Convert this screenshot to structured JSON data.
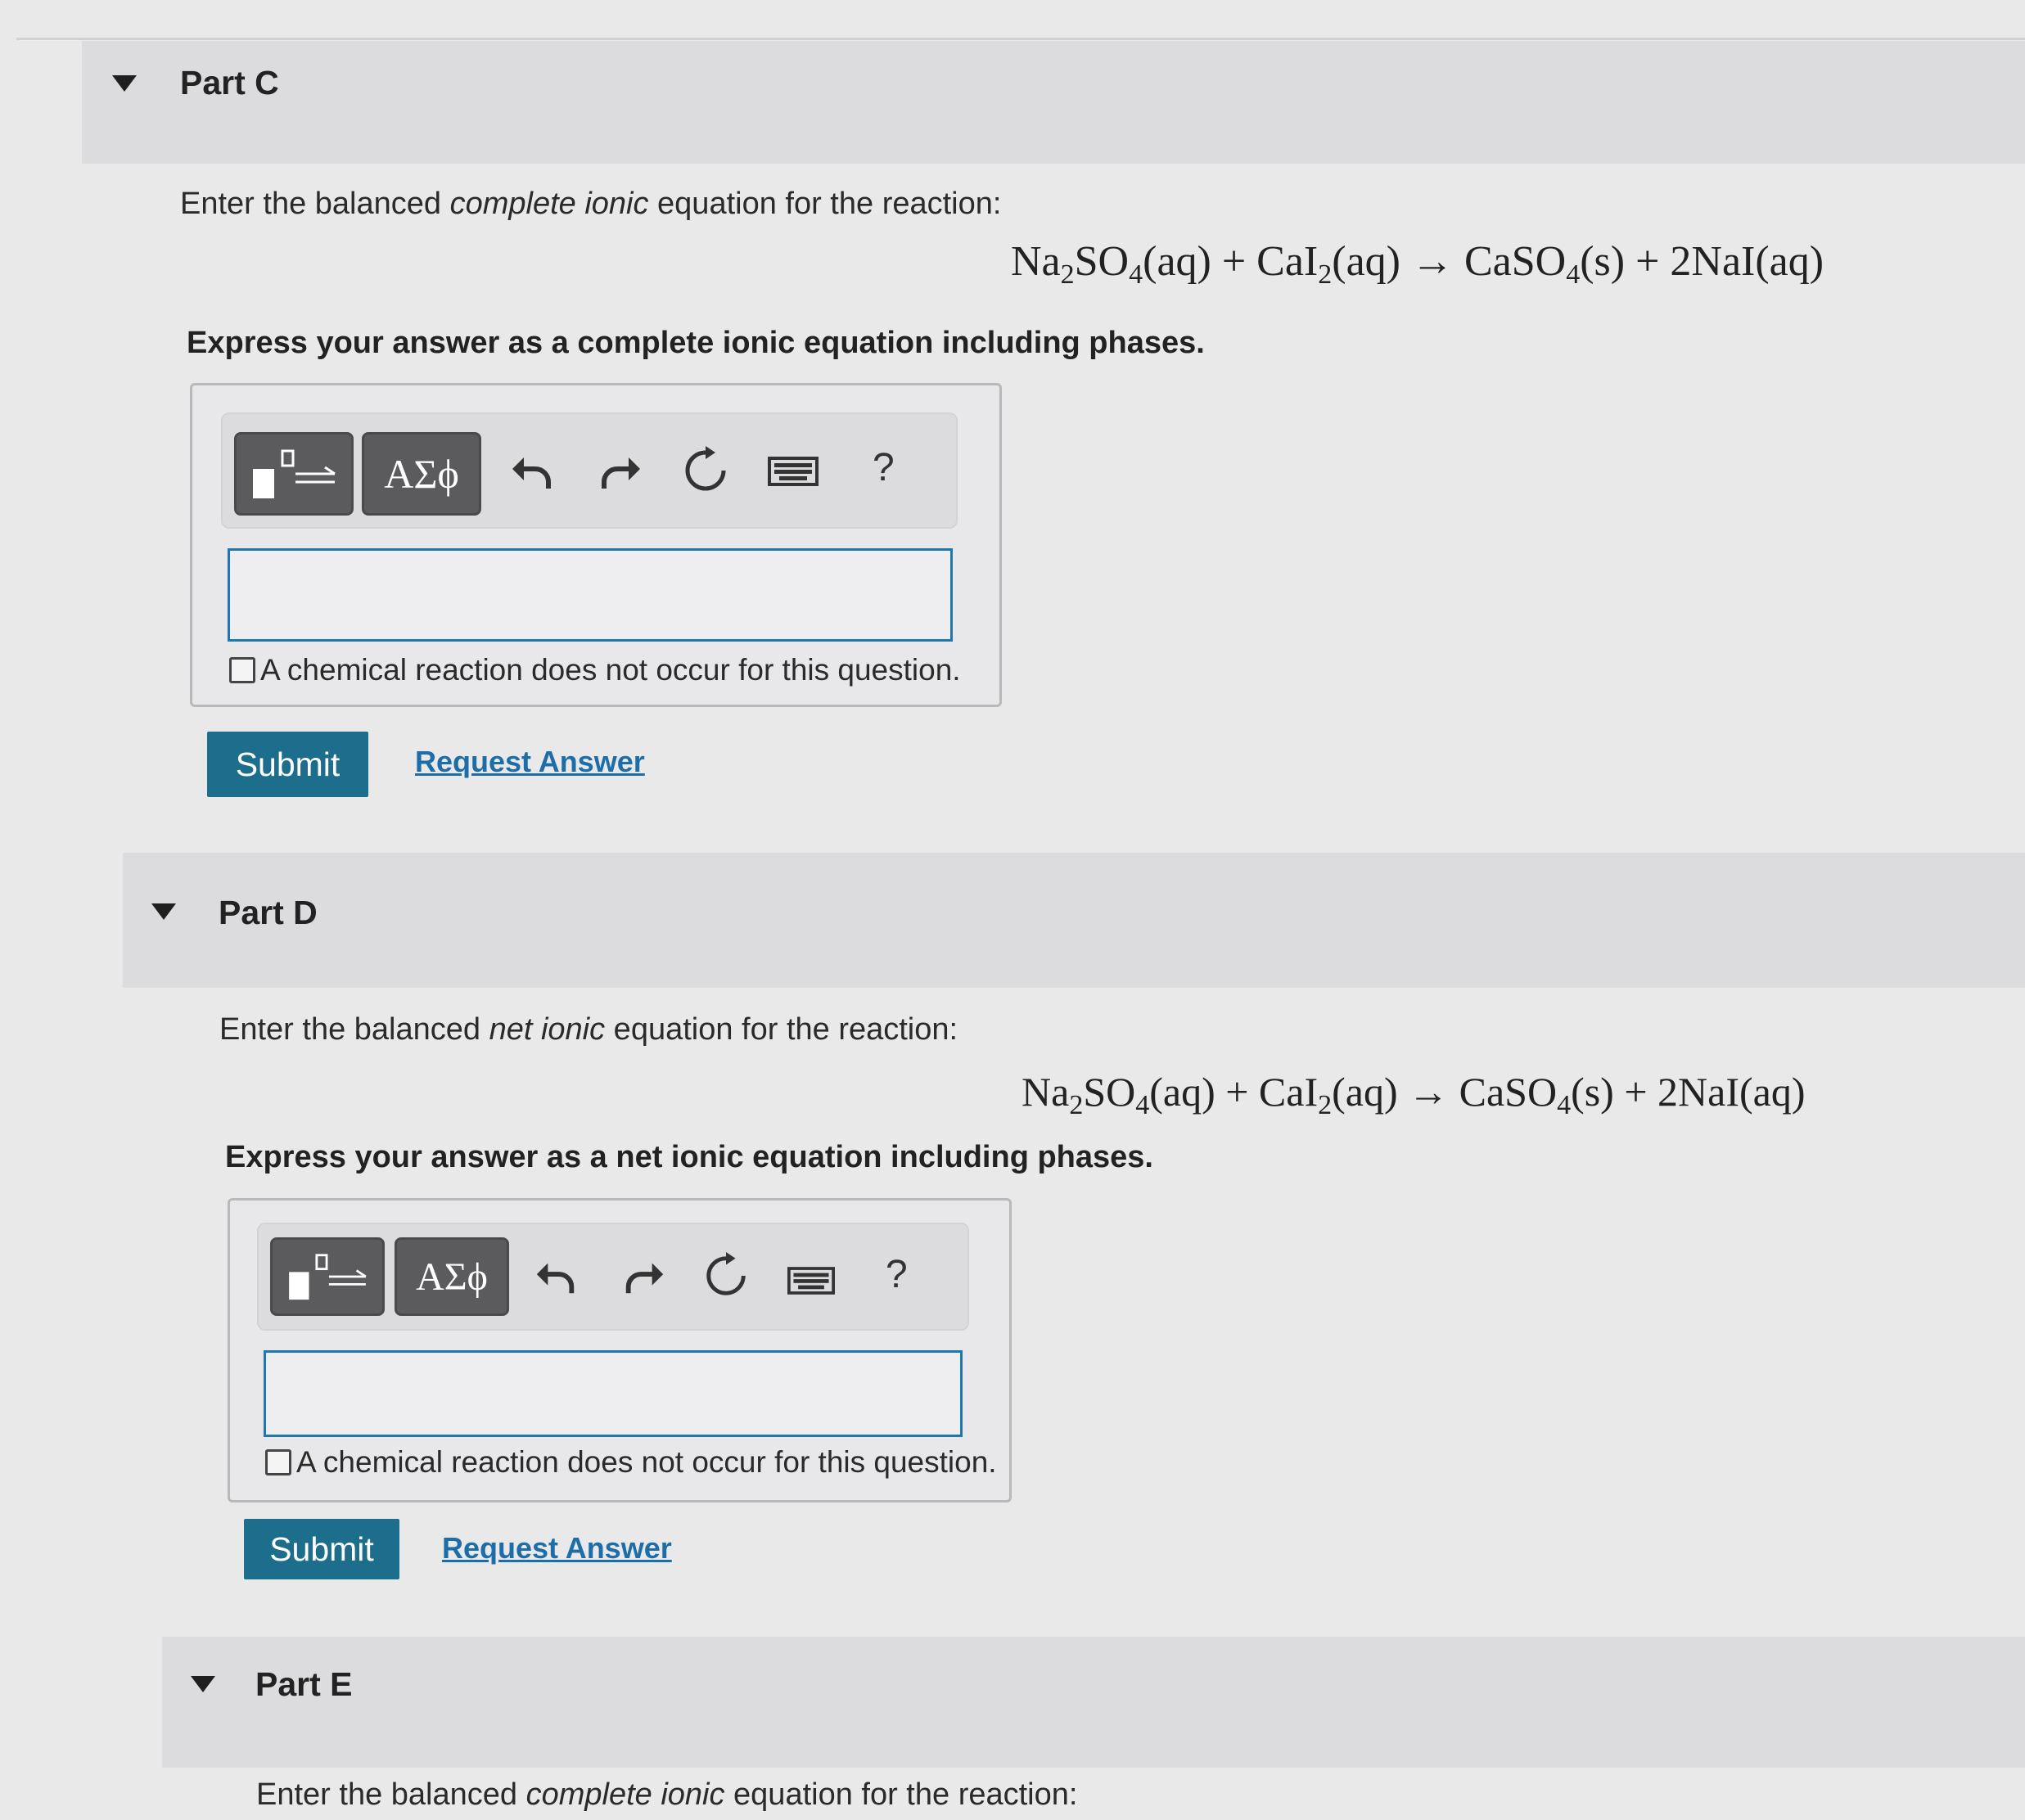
{
  "equation": {
    "reactant1_prefix": "Na",
    "reactant1_sub1": "2",
    "reactant1_mid": "SO",
    "reactant1_sub2": "4",
    "reactant1_phase": "(aq) + CaI",
    "reactant2_sub": "2",
    "reactant2_phase": "(aq) → CaSO",
    "product1_sub": "4",
    "product_tail": "(s) + 2NaI(aq)"
  },
  "toolbar": {
    "greek_label": "ΑΣϕ",
    "help_label": "?"
  },
  "part_c": {
    "title": "Part C",
    "prompt_before": "Enter the balanced ",
    "prompt_em": "complete ionic",
    "prompt_after": " equation for the reaction:",
    "instruction": "Express your answer as a complete ionic equation including phases.",
    "answer_value": "",
    "no_reaction_label": "A chemical reaction does not occur for this question.",
    "submit_label": "Submit",
    "request_label": "Request Answer"
  },
  "part_d": {
    "title": "Part D",
    "prompt_before": "Enter the balanced ",
    "prompt_em": "net ionic",
    "prompt_after": " equation for the reaction:",
    "instruction": "Express your answer as a net ionic equation including phases.",
    "answer_value": "",
    "no_reaction_label": "A chemical reaction does not occur for this question.",
    "submit_label": "Submit",
    "request_label": "Request Answer"
  },
  "part_e": {
    "title": "Part E",
    "prompt_before": "Enter the balanced ",
    "prompt_em": "complete ionic",
    "prompt_after": " equation for the reaction:"
  },
  "colors": {
    "accent": "#1c6e8c",
    "link": "#1d6ea8",
    "answer_border": "#1f77ad"
  }
}
